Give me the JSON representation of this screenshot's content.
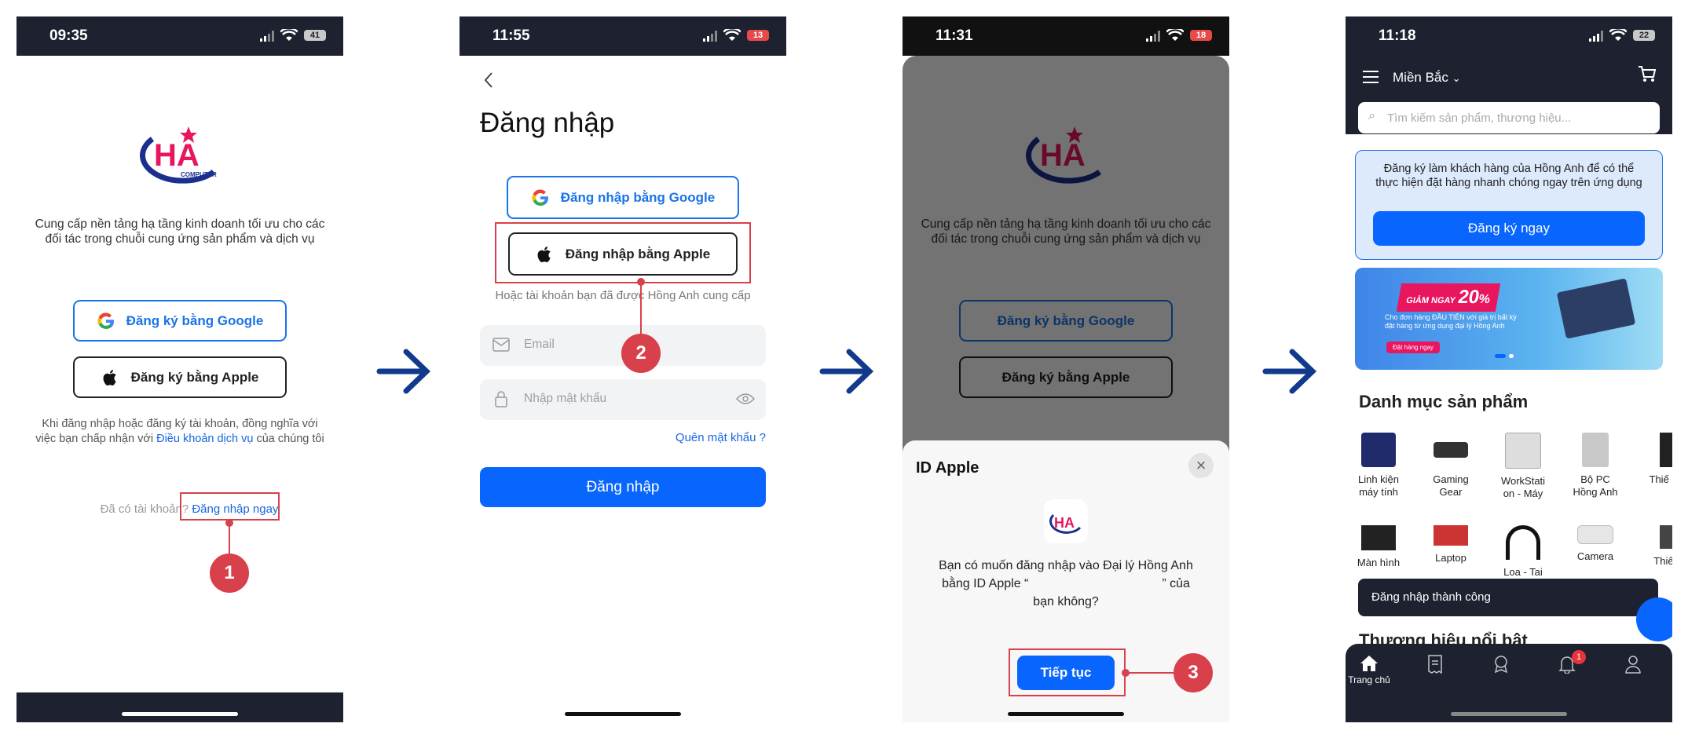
{
  "colors": {
    "accent": "#0866ff",
    "callout": "#d8404b",
    "dark": "#1e2230",
    "arrow": "#123a8c"
  },
  "screen1": {
    "time": "09:35",
    "battery": "41",
    "logo_text": "HA",
    "logo_sub": "COMPUTER",
    "tagline": "Cung cấp nền tảng hạ tầng kinh doanh tối ưu cho các đối tác trong chuỗi cung ứng sản phẩm và dịch vụ",
    "google_btn": "Đăng ký bằng Google",
    "apple_btn": "Đăng ký bằng Apple",
    "terms_prefix": "Khi đăng nhập hoặc đăng ký tài khoản, đồng nghĩa với việc bạn chấp nhận với ",
    "terms_link": "Điều khoản dịch vụ",
    "terms_suffix": " của chúng tôi",
    "have_account": "Đã có tài khoản?",
    "login_now": "Đăng nhập ngay",
    "callout": "1"
  },
  "screen2": {
    "time": "11:55",
    "battery": "13",
    "title": "Đăng nhập",
    "google_btn": "Đăng nhập bằng Google",
    "apple_btn": "Đăng nhập bằng Apple",
    "or_text": "Hoặc tài khoản bạn đã được Hồng Anh cung cấp",
    "email_placeholder": "Email",
    "password_placeholder": "Nhập mật khẩu",
    "forgot": "Quên mật khẩu ?",
    "login_btn": "Đăng nhập",
    "callout": "2"
  },
  "screen3": {
    "time": "11:31",
    "battery": "18",
    "modal_title": "ID Apple",
    "modal_text_1": "Bạn có muốn đăng nhập vào Đại lý Hồng Anh",
    "modal_text_2a": "bằng ID Apple “",
    "modal_text_2b": "” của",
    "modal_text_3": "bạn không?",
    "continue_btn": "Tiếp tục",
    "callout": "3"
  },
  "screen4": {
    "time": "11:18",
    "battery": "22",
    "region": "Miền Bắc",
    "search_placeholder": "Tìm kiếm sản phẩm, thương hiệu...",
    "promo_text": "Đăng ký làm khách hàng của Hồng Anh để có thể thực hiện đặt hàng nhanh chóng ngay trên ứng dụng",
    "register_btn": "Đăng ký ngay",
    "banner_tag": "GIẢM NGAY",
    "banner_pct": "20",
    "banner_line": "Cho đơn hàng ĐẦU TIÊN với giá trị bất kỳ đặt hàng từ ứng dụng đại lý Hồng Anh",
    "banner_btn": "Đặt hàng ngay",
    "section_title": "Danh mục sản phẩm",
    "categories_row1": [
      "Linh kiện máy tính",
      "Gaming Gear",
      "WorkStati on - Máy",
      "Bộ PC Hồng Anh",
      "Thiế mạ"
    ],
    "categories_row2": [
      "Màn hình",
      "Laptop",
      "Loa - Tai",
      "Camera",
      "Thiế v"
    ],
    "toast": "Đăng nhập thành công",
    "next_section": "Thương hiệu nổi bật",
    "tab_home": "Trang chủ",
    "notif_count": "1"
  }
}
